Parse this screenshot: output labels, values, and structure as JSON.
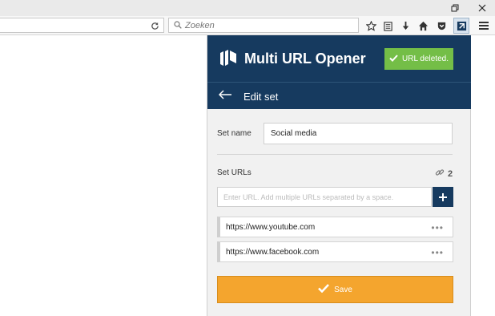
{
  "browser": {
    "search_placeholder": "Zoeken",
    "window_buttons": [
      "restore",
      "close"
    ]
  },
  "popup": {
    "app_title": "Multi URL Opener",
    "toast": "URL deleted.",
    "subtitle": "Edit set",
    "set_name_label": "Set name",
    "set_name_value": "Social media",
    "set_urls_label": "Set URLs",
    "url_count": "2",
    "url_input_placeholder": "Enter URL. Add multiple URLs separated by a space.",
    "urls": [
      "https://www.youtube.com",
      "https://www.facebook.com"
    ],
    "save_label": "Save"
  },
  "colors": {
    "header": "#163a5f",
    "toast": "#74be47",
    "save": "#f4a52e"
  }
}
